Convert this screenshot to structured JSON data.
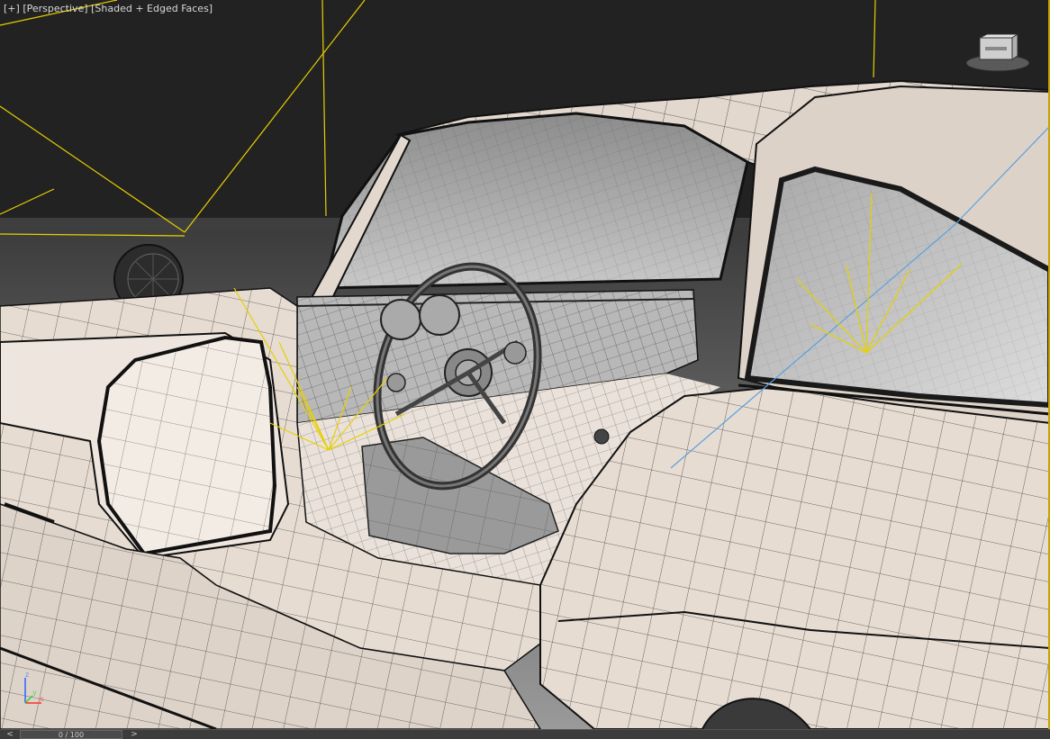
{
  "viewport": {
    "label_plus": "[+]",
    "label_view": "[Perspective]",
    "label_shading": "[Shaded + Edged Faces]",
    "background": "#222222",
    "border_accent": "#c8a200"
  },
  "scene": {
    "object": "car-interior-wireframe",
    "body_color": "#e6dcd2",
    "edge_color": "#1a1a1a",
    "light_color": "#e8d000",
    "selection_line_color": "#5aa0e0"
  },
  "viewcube": {
    "icon": "viewcube-icon"
  },
  "axis_gizmo": {
    "x": "x",
    "y": "y",
    "z": "z"
  },
  "timeline": {
    "prev_label": "<",
    "next_label": ">",
    "frame_text": "0 / 100"
  }
}
